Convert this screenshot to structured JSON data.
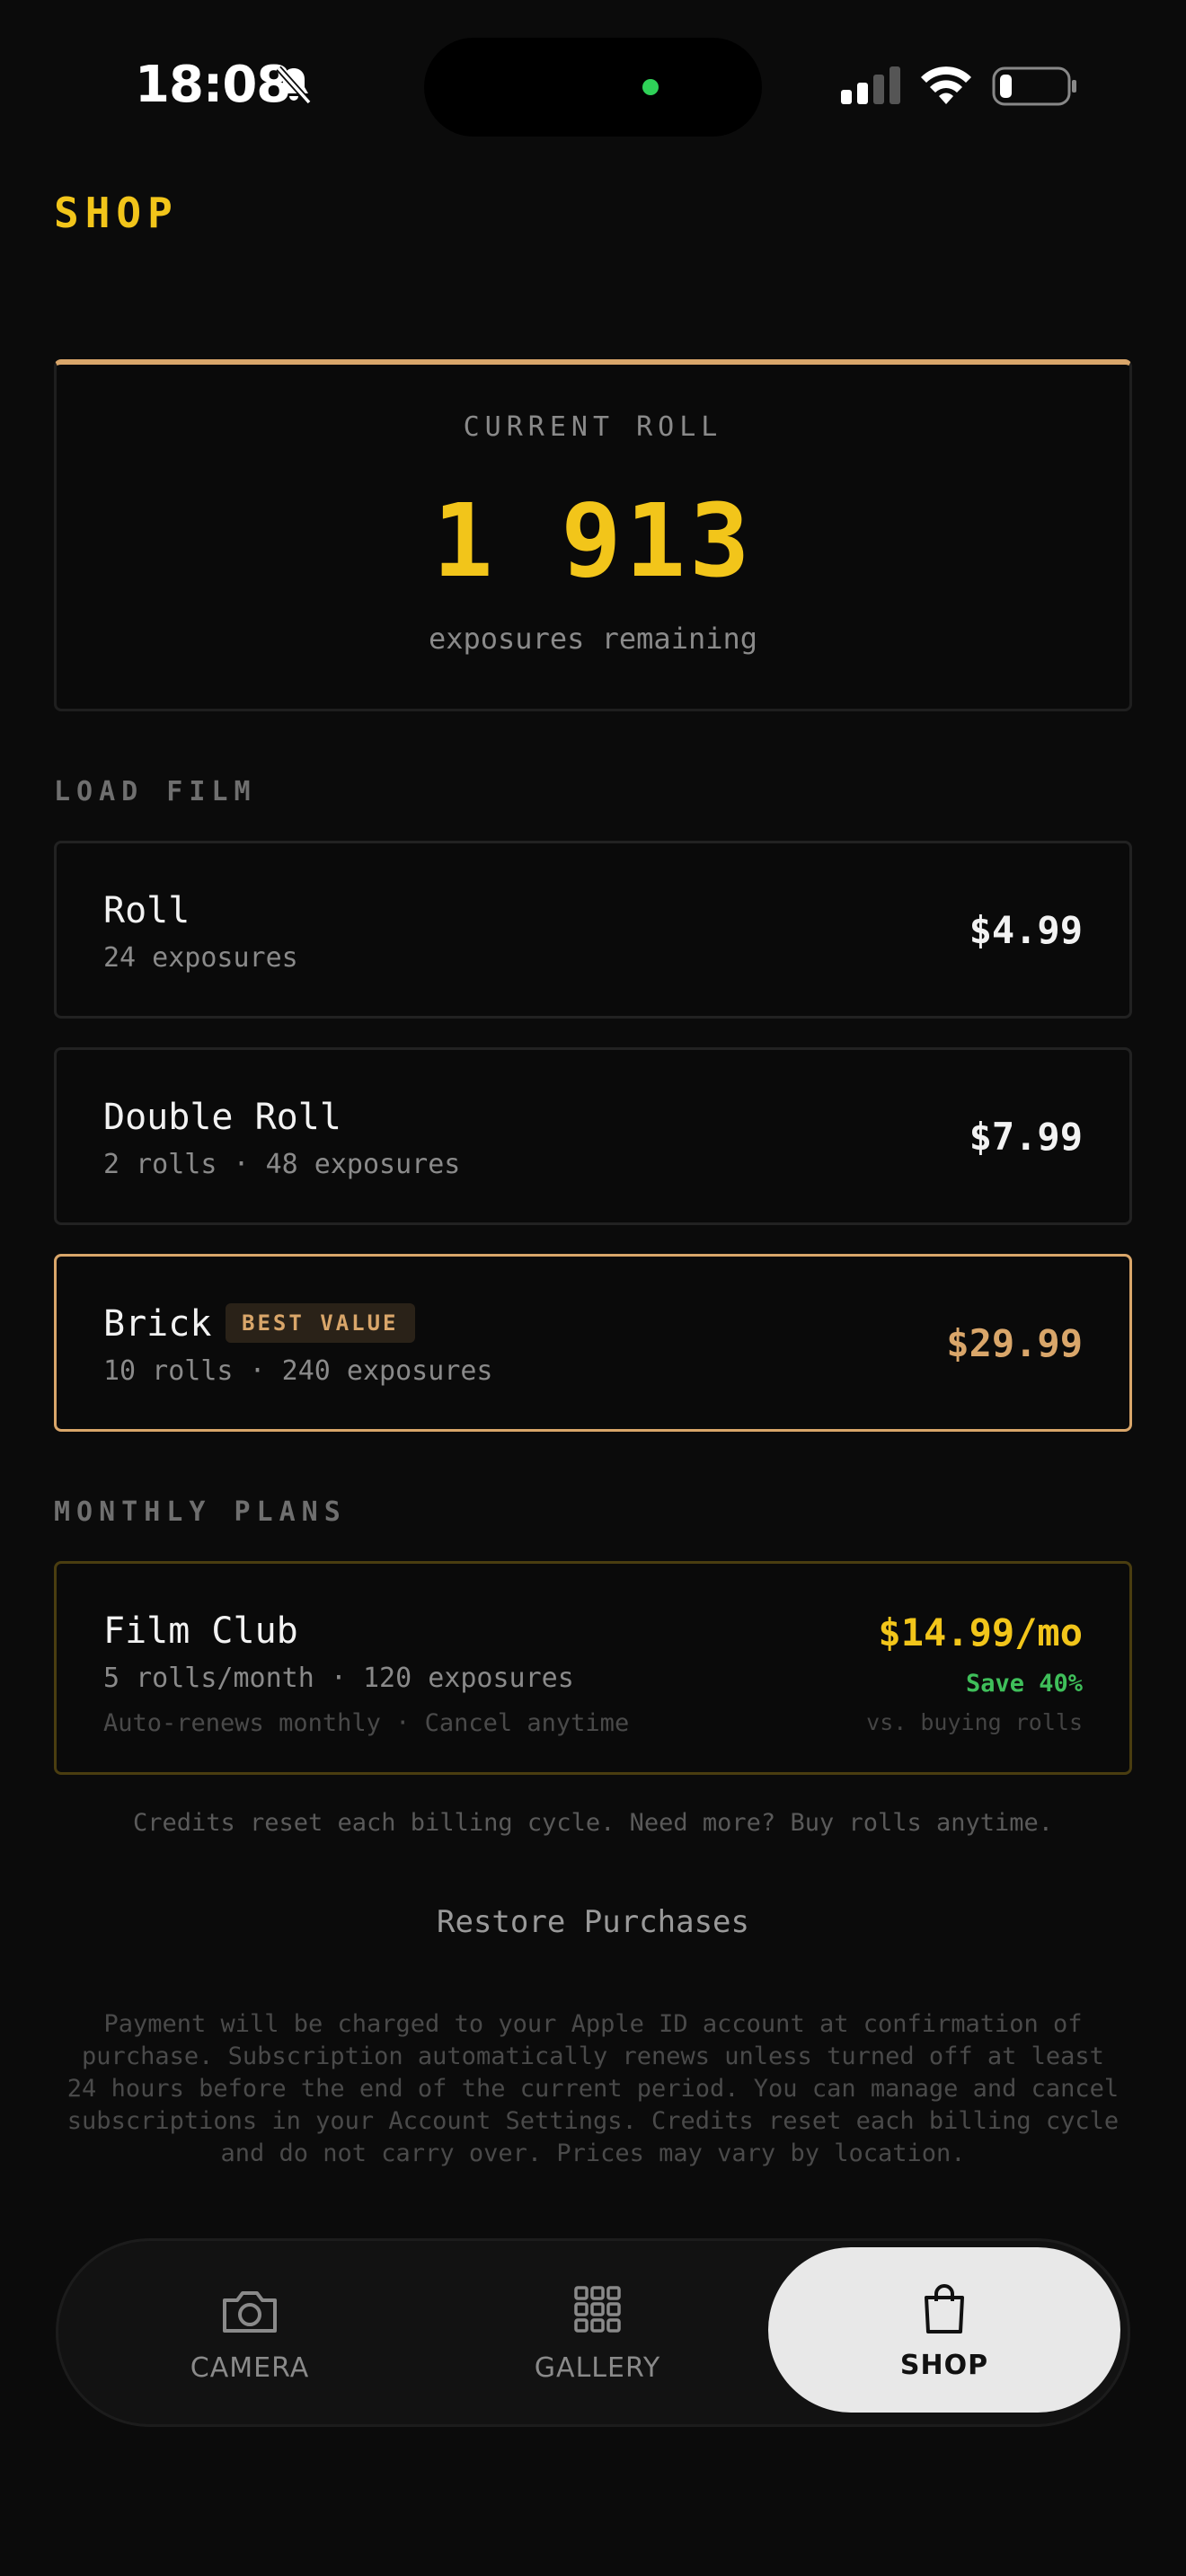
{
  "status_bar": {
    "time": "18:08"
  },
  "page": {
    "title": "SHOP"
  },
  "current_roll": {
    "label": "CURRENT ROLL",
    "value": "1 913",
    "sub": "exposures remaining"
  },
  "load_film": {
    "heading": "LOAD FILM",
    "products": [
      {
        "name": "Roll",
        "detail": "24 exposures",
        "price": "$4.99",
        "badge": ""
      },
      {
        "name": "Double Roll",
        "detail": "2 rolls · 48 exposures",
        "price": "$7.99",
        "badge": ""
      },
      {
        "name": "Brick",
        "detail": "10 rolls · 240 exposures",
        "price": "$29.99",
        "badge": "BEST VALUE"
      }
    ]
  },
  "monthly_plans": {
    "heading": "MONTHLY PLANS",
    "plan": {
      "name": "Film Club",
      "detail": "5 rolls/month · 120 exposures",
      "note": "Auto-renews monthly · Cancel anytime",
      "price": "$14.99/mo",
      "save": "Save 40%",
      "save_note": "vs. buying rolls"
    }
  },
  "reset_note": "Credits reset each billing cycle. Need more? Buy rolls anytime.",
  "restore_label": "Restore Purchases",
  "legal": "Payment will be charged to your Apple ID account at confirmation of purchase. Subscription automatically renews unless turned off at least 24 hours before the end of the current period. You can manage and cancel subscriptions in your Account Settings. Credits reset each billing cycle and do not carry over. Prices may vary by location.",
  "tabs": [
    {
      "label": "CAMERA",
      "icon": "camera-icon",
      "active": false
    },
    {
      "label": "GALLERY",
      "icon": "grid-icon",
      "active": false
    },
    {
      "label": "SHOP",
      "icon": "shopping-bag-icon",
      "active": true
    }
  ],
  "colors": {
    "accent": "#f2c51a",
    "best_value": "#d9a66a",
    "save": "#3fbf5a",
    "background": "#0b0b0b"
  }
}
